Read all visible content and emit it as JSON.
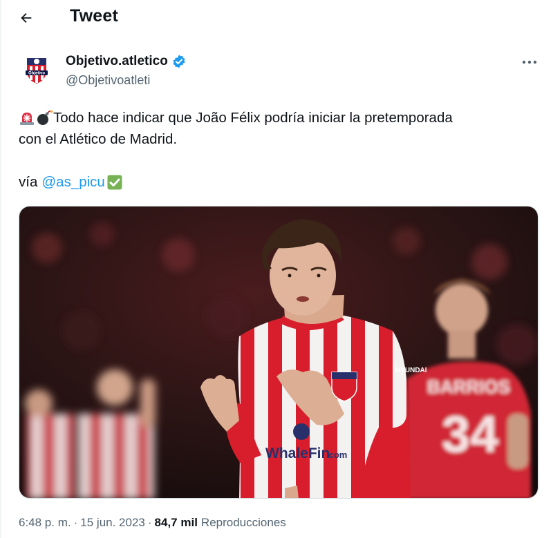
{
  "header": {
    "title": "Tweet"
  },
  "author": {
    "name": "Objetivo.atletico",
    "handle": "@Objetivoatleti",
    "verified": true,
    "avatar_text": "Objetivo"
  },
  "tweet": {
    "emojis": [
      "rotating-light",
      "bomb"
    ],
    "line1": "Todo hace indicar que João Félix podría iniciar la pretemporada",
    "line2": "con el Atlético de Madrid.",
    "via_label": "vía",
    "mention": "@as_picu",
    "trailing_emoji": "check-mark-button"
  },
  "media": {
    "sponsor_text": "WhaleFin",
    "sponsor_suffix": ".com",
    "sleeve_text": "HYUNDAI",
    "background_player_name": "BARRIOS",
    "background_player_number": "34"
  },
  "meta": {
    "time": "6:48 p. m.",
    "separator": "·",
    "date": "15 jun. 2023",
    "views_count": "84,7 mil",
    "views_label": "Reproducciones"
  },
  "colors": {
    "link": "#1d9bf0",
    "secondary_text": "#536471",
    "verified": "#1d9bf0",
    "jersey_red": "#d81e2c"
  }
}
